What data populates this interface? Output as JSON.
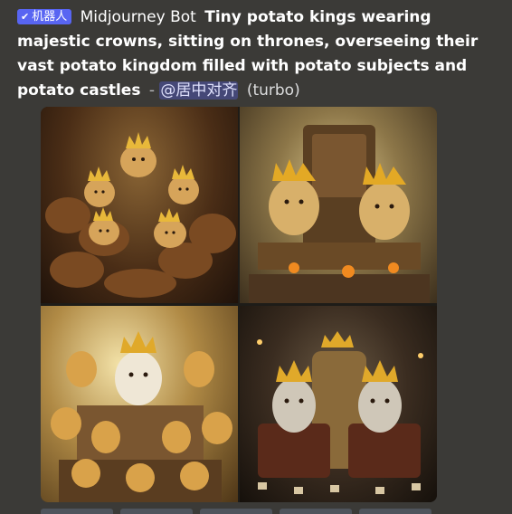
{
  "message": {
    "bot_tag": "机器人",
    "author": "Midjourney Bot",
    "prompt": "Tiny potato kings wearing majestic crowns, sitting on thrones, overseeing their vast potato kingdom filled with potato subjects and potato castles",
    "separator": "-",
    "mention": "@居中对齐",
    "mode": "(turbo)"
  },
  "image_grid": {
    "tiles": [
      {
        "label": "image 1"
      },
      {
        "label": "image 2"
      },
      {
        "label": "image 3"
      },
      {
        "label": "image 4"
      }
    ]
  },
  "colors": {
    "background": "#3b3a37",
    "bot_tag": "#5865f2",
    "mention_bg": "#5865f259"
  }
}
